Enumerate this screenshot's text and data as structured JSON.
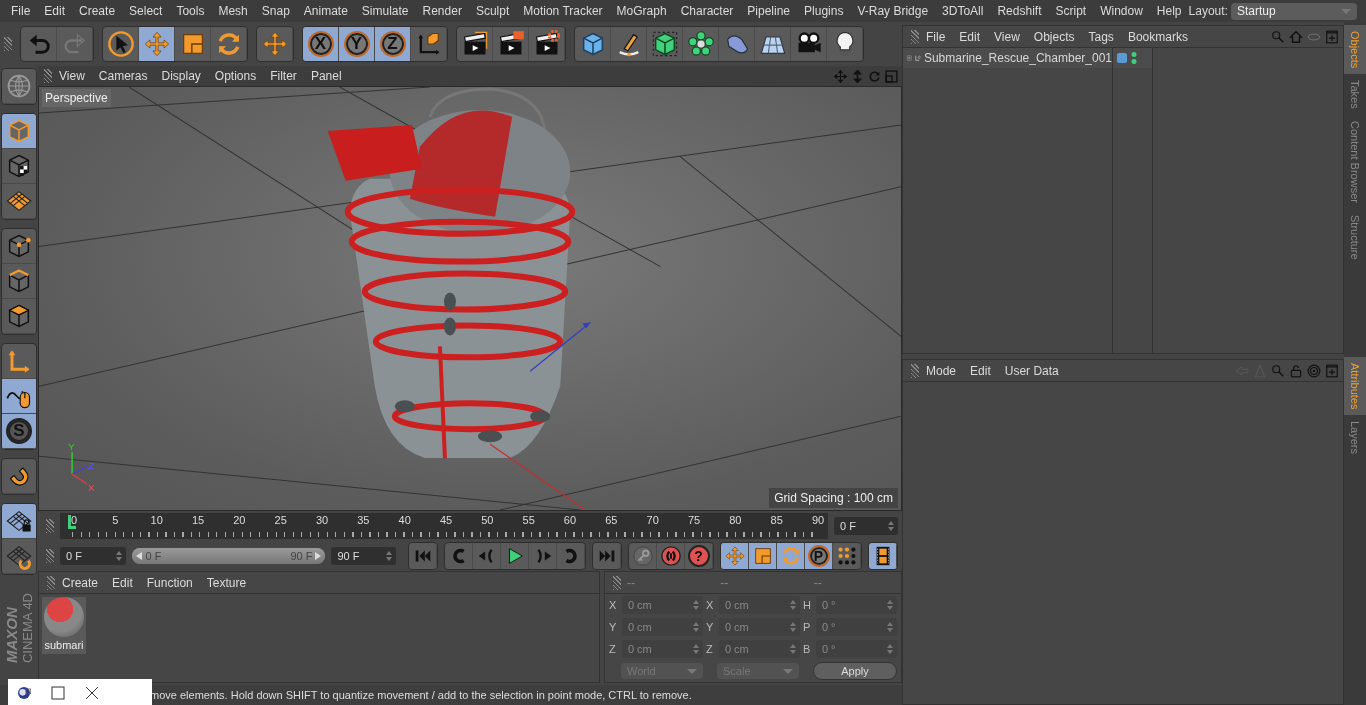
{
  "menu_bar": {
    "items": [
      "File",
      "Edit",
      "Create",
      "Select",
      "Tools",
      "Mesh",
      "Snap",
      "Animate",
      "Simulate",
      "Render",
      "Sculpt",
      "Motion Tracker",
      "MoGraph",
      "Character",
      "Pipeline",
      "Plugins",
      "V-Ray Bridge",
      "3DToAll",
      "Redshift",
      "Script",
      "Window",
      "Help"
    ],
    "layout_label": "Layout:",
    "layout_value": "Startup"
  },
  "main_toolbar": [
    {
      "buttons": [
        {
          "kind": "undo",
          "selected": false
        },
        {
          "kind": "redo",
          "selected": false
        }
      ]
    },
    {
      "buttons": [
        {
          "kind": "live-select",
          "selected": false
        },
        {
          "kind": "move",
          "selected": true
        },
        {
          "kind": "scale",
          "selected": false
        },
        {
          "kind": "rotate",
          "selected": false
        }
      ]
    },
    {
      "buttons": [
        {
          "kind": "move",
          "selected": false
        }
      ]
    },
    {
      "buttons": [
        {
          "kind": "axis-lock",
          "label": "X",
          "selected": true
        },
        {
          "kind": "axis-lock",
          "label": "Y",
          "selected": true
        },
        {
          "kind": "axis-lock",
          "label": "Z",
          "selected": true
        },
        {
          "kind": "coordinate-system",
          "selected": false
        }
      ]
    },
    {
      "buttons": [
        {
          "kind": "render-view",
          "selected": false
        },
        {
          "kind": "render-picture",
          "selected": false
        },
        {
          "kind": "render-settings",
          "selected": false
        }
      ]
    },
    {
      "buttons": [
        {
          "kind": "cube",
          "selected": false
        },
        {
          "kind": "pen",
          "selected": false
        },
        {
          "kind": "subdivision",
          "selected": false
        },
        {
          "kind": "cloner",
          "selected": false
        },
        {
          "kind": "deformer",
          "selected": false
        },
        {
          "kind": "floor",
          "selected": false
        },
        {
          "kind": "camera",
          "selected": false
        },
        {
          "kind": "light",
          "selected": false
        }
      ]
    }
  ],
  "left_toolbar": [
    {
      "buttons": [
        {
          "kind": "make-editable",
          "selected": false
        }
      ]
    },
    {
      "buttons": [
        {
          "kind": "model",
          "selected": true
        },
        {
          "kind": "texture",
          "selected": false
        },
        {
          "kind": "workplane",
          "selected": false
        }
      ]
    },
    {
      "buttons": [
        {
          "kind": "points",
          "selected": false
        },
        {
          "kind": "edges",
          "selected": false
        },
        {
          "kind": "polygons",
          "selected": false
        }
      ]
    },
    {
      "buttons": [
        {
          "kind": "axis",
          "selected": false
        },
        {
          "kind": "tweak",
          "selected": true
        },
        {
          "kind": "solo",
          "label": "S",
          "selected": true
        }
      ]
    },
    {
      "buttons": [
        {
          "kind": "snap",
          "selected": false
        }
      ]
    },
    {
      "buttons": [
        {
          "kind": "lock-workplane",
          "selected": true
        },
        {
          "kind": "workplane-sync",
          "selected": false
        }
      ]
    }
  ],
  "viewport": {
    "menu": [
      "View",
      "Cameras",
      "Display",
      "Options",
      "Filter",
      "Panel"
    ],
    "camera": "Perspective",
    "grid_spacing": "Grid Spacing : 100 cm",
    "axis_labels": [
      "Y",
      "Z",
      "X"
    ]
  },
  "timeline": {
    "labels": [
      "0",
      "5",
      "10",
      "15",
      "20",
      "25",
      "30",
      "35",
      "40",
      "45",
      "50",
      "55",
      "60",
      "65",
      "70",
      "75",
      "80",
      "85",
      "90"
    ],
    "playhead": {
      "level": 0
    },
    "frame_field": "0 F"
  },
  "playback": {
    "start": "0 F",
    "range": {
      "start": "0 F",
      "end": "90 F",
      "level": 1
    },
    "end": "90 F",
    "groups": [
      {
        "buttons": [
          {
            "kind": "goto-start",
            "selected": false
          }
        ]
      },
      {
        "buttons": [
          {
            "kind": "prev-key",
            "selected": false
          },
          {
            "kind": "prev-frame",
            "selected": false
          },
          {
            "kind": "play",
            "selected": false
          },
          {
            "kind": "next-frame",
            "selected": false
          },
          {
            "kind": "next-key",
            "selected": false
          }
        ]
      },
      {
        "buttons": [
          {
            "kind": "goto-end",
            "selected": false
          }
        ]
      },
      {
        "buttons": [
          {
            "kind": "key",
            "selected": false
          },
          {
            "kind": "record",
            "selected": false
          },
          {
            "kind": "autokey",
            "label": "?",
            "selected": false
          }
        ]
      },
      {
        "buttons": [
          {
            "kind": "move",
            "selected": true
          },
          {
            "kind": "scale",
            "selected": true
          },
          {
            "kind": "rotate",
            "selected": true
          },
          {
            "kind": "param",
            "label": "P",
            "selected": true
          },
          {
            "kind": "dots",
            "selected": false
          }
        ]
      },
      {
        "buttons": [
          {
            "kind": "film",
            "selected": true
          }
        ]
      }
    ]
  },
  "material_manager": {
    "menu": [
      "Create",
      "Edit",
      "Function",
      "Texture"
    ],
    "materials": [
      {
        "name": "submari"
      }
    ]
  },
  "coordinates": {
    "headers": [
      "--",
      "--",
      "--"
    ],
    "rows": [
      {
        "position_axis": "X",
        "position": "0 cm",
        "size_axis": "X",
        "size": "0 cm",
        "rotation_axis": "H",
        "rotation": "0 °"
      },
      {
        "position_axis": "Y",
        "position": "0 cm",
        "size_axis": "Y",
        "size": "0 cm",
        "rotation_axis": "P",
        "rotation": "0 °"
      },
      {
        "position_axis": "Z",
        "position": "0 cm",
        "size_axis": "Z",
        "size": "0 cm",
        "rotation_axis": "B",
        "rotation": "0 °"
      }
    ],
    "dropdowns": [
      "World",
      "Scale"
    ],
    "apply": "Apply"
  },
  "logo": {
    "brand": "MAXON",
    "product": "CINEMA 4D"
  },
  "status_bar": {
    "text": "move elements. Hold down SHIFT to quantize movement / add to the selection in point mode, CTRL to remove."
  },
  "objects_manager": {
    "menu": [
      "File",
      "Edit",
      "View",
      "Objects",
      "Tags",
      "Bookmarks"
    ],
    "objects": [
      {
        "name": "Submarine_Rescue_Chamber_001",
        "expanded": false,
        "color": "#5b9bd5"
      }
    ]
  },
  "attributes_manager": {
    "menu": [
      "Mode",
      "Edit",
      "User Data"
    ]
  },
  "side_tabs_top": [
    {
      "label": "Objects",
      "selected": true
    },
    {
      "label": "Takes",
      "selected": false
    },
    {
      "label": "Content Browser",
      "selected": false
    },
    {
      "label": "Structure",
      "selected": false
    }
  ],
  "side_tabs_bottom": [
    {
      "label": "Attributes",
      "selected": true
    },
    {
      "label": "Layers",
      "selected": false
    }
  ]
}
